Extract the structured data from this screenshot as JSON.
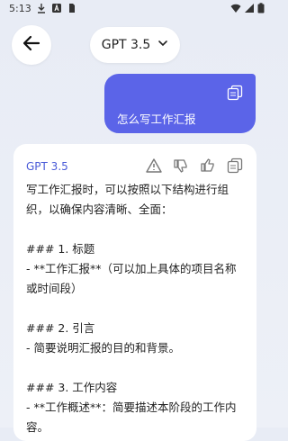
{
  "status_bar": {
    "time": "5:13",
    "left_icons": [
      "download-icon",
      "text-a-icon",
      "sim-icon"
    ],
    "right_icons": [
      "wifi-icon",
      "signal-icon",
      "battery-icon"
    ]
  },
  "header": {
    "model_name": "GPT 3.5",
    "back_icon": "arrow-left-icon",
    "dropdown_icon": "chevron-down-icon"
  },
  "user_message": {
    "text": "怎么写工作汇报",
    "copy_icon": "copy-icon",
    "bubble_color": "#5b64e8"
  },
  "ai_message": {
    "model_label": "GPT 3.5",
    "actions": [
      "warning-icon",
      "thumbs-down-icon",
      "thumbs-up-icon",
      "copy-icon"
    ],
    "lines": [
      "写工作汇报时，可以按照以下结构进行组织，以确保内容清晰、全面：",
      "",
      "### 1. 标题",
      "- **工作汇报**（可以加上具体的项目名称或时间段）",
      "",
      "### 2. 引言",
      "- 简要说明汇报的目的和背景。",
      "",
      "### 3. 工作内容",
      "- **工作概述**：简要描述本阶段的工作内容。"
    ],
    "accent_color": "#4a5bd8"
  }
}
